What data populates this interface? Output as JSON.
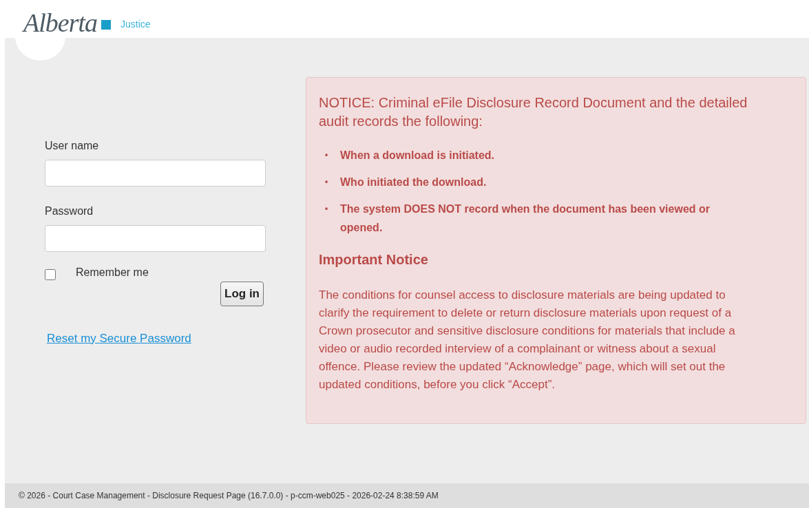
{
  "header": {
    "logo_text": "Alberta",
    "department": "Justice"
  },
  "login": {
    "fields": [
      {
        "label": "User name"
      },
      {
        "label": "Password"
      }
    ],
    "remember": {
      "label": "Remember me",
      "checked": false
    },
    "button": "Log in",
    "reset_link": "Reset my Secure Password"
  },
  "notice": {
    "heading": "NOTICE: Criminal eFile Disclosure Record Document and the detailed audit records the following:",
    "items": [
      {
        "marker": "•",
        "text": "When a download is initiated."
      },
      {
        "marker": "•",
        "text": "Who initiated the download."
      },
      {
        "marker": "•",
        "text": "The system DOES NOT record when the document has been viewed or opened."
      }
    ],
    "subheading": "Important Notice",
    "body": "The conditions for counsel access to disclosure materials are being updated to clarify the requirement to delete or return disclosure materials upon request of a Crown prosecutor and sensitive disclosure conditions for materials that include a video or audio recorded interview of a complainant or witness about a sexual offence. Please review the updated “Acknowledge” page, which will set out the updated conditions, before you click “Accept”."
  },
  "footer": "© 2026 - Court Case Management - Disclosure Request Page (16.7.0.0) - p-ccm-web025 - 2026-02-24 8:38:59 AM"
}
